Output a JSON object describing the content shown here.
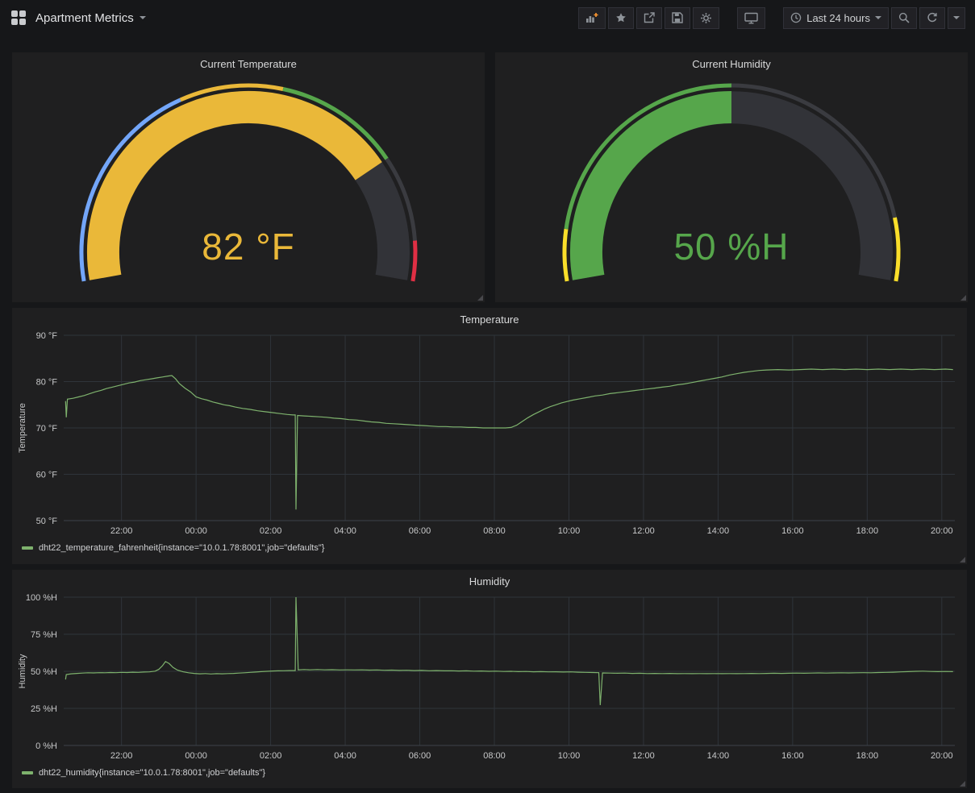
{
  "navbar": {
    "title": "Apartment Metrics",
    "time_range": "Last 24 hours",
    "icons": [
      "grafana-grid",
      "add-panel",
      "star",
      "share",
      "save",
      "settings",
      "cycle-view",
      "clock",
      "zoom-out",
      "refresh",
      "caret-down"
    ]
  },
  "chart_data": [
    {
      "type": "gauge",
      "title": "Current Temperature",
      "value": 82,
      "unit": "°F",
      "display": "82 °F",
      "min": 50,
      "max": 91,
      "fill_fraction": 0.78,
      "fill_color": "#eab839",
      "value_color": "#eab839",
      "ring": [
        {
          "from": 0.0,
          "to": 0.38,
          "color": "#73a6f9"
        },
        {
          "from": 0.38,
          "to": 0.56,
          "color": "#eab839"
        },
        {
          "from": 0.56,
          "to": 0.78,
          "color": "#56a64b"
        },
        {
          "from": 0.78,
          "to": 0.93,
          "color": "#3a3b40"
        },
        {
          "from": 0.93,
          "to": 1.0,
          "color": "#e02f44"
        }
      ]
    },
    {
      "type": "gauge",
      "title": "Current Humidity",
      "value": 50,
      "unit": "%H",
      "display": "50 %H",
      "min": 0,
      "max": 100,
      "fill_fraction": 0.5,
      "fill_color": "#56a64b",
      "value_color": "#56a64b",
      "ring": [
        {
          "from": 0.0,
          "to": 0.09,
          "color": "#fade2a"
        },
        {
          "from": 0.09,
          "to": 0.5,
          "color": "#56a64b"
        },
        {
          "from": 0.5,
          "to": 0.89,
          "color": "#3a3b40"
        },
        {
          "from": 0.89,
          "to": 1.0,
          "color": "#fade2a"
        }
      ]
    },
    {
      "type": "line",
      "title": "Temperature",
      "ylabel": "Temperature",
      "legend": "dht22_temperature_fahrenheit{instance=\"10.0.1.78:8001\",job=\"defaults\"}",
      "color": "#7eb26d",
      "x_unit": "hours since 22:00",
      "x_domain": [
        -1.55,
        22.35
      ],
      "y_domain": [
        50,
        90
      ],
      "x_ticks": [
        0,
        2,
        4,
        6,
        8,
        10,
        12,
        14,
        16,
        18,
        20,
        22
      ],
      "x_tick_labels": [
        "22:00",
        "00:00",
        "02:00",
        "04:00",
        "06:00",
        "08:00",
        "10:00",
        "12:00",
        "14:00",
        "16:00",
        "18:00",
        "20:00"
      ],
      "y_ticks": [
        50,
        60,
        70,
        80,
        90
      ],
      "y_tick_labels": [
        "50 °F",
        "60 °F",
        "70 °F",
        "80 °F",
        "90 °F"
      ],
      "points": [
        [
          -1.5,
          75.8
        ],
        [
          -1.48,
          72.3
        ],
        [
          -1.45,
          76.2
        ],
        [
          -1.3,
          76.4
        ],
        [
          -1.15,
          76.7
        ],
        [
          -1.0,
          77.0
        ],
        [
          -0.85,
          77.4
        ],
        [
          -0.7,
          77.8
        ],
        [
          -0.55,
          78.1
        ],
        [
          -0.4,
          78.5
        ],
        [
          -0.25,
          78.8
        ],
        [
          -0.1,
          79.1
        ],
        [
          0.05,
          79.4
        ],
        [
          0.2,
          79.7
        ],
        [
          0.35,
          79.9
        ],
        [
          0.5,
          80.2
        ],
        [
          0.65,
          80.4
        ],
        [
          0.8,
          80.6
        ],
        [
          0.95,
          80.8
        ],
        [
          1.1,
          81.0
        ],
        [
          1.25,
          81.2
        ],
        [
          1.35,
          81.3
        ],
        [
          1.45,
          80.6
        ],
        [
          1.55,
          79.6
        ],
        [
          1.7,
          78.6
        ],
        [
          1.85,
          77.8
        ],
        [
          2.0,
          76.7
        ],
        [
          2.15,
          76.3
        ],
        [
          2.3,
          76.0
        ],
        [
          2.45,
          75.6
        ],
        [
          2.6,
          75.3
        ],
        [
          2.75,
          75.0
        ],
        [
          2.9,
          74.8
        ],
        [
          3.05,
          74.5
        ],
        [
          3.25,
          74.2
        ],
        [
          3.45,
          74.0
        ],
        [
          3.65,
          73.7
        ],
        [
          3.85,
          73.5
        ],
        [
          4.05,
          73.3
        ],
        [
          4.25,
          73.1
        ],
        [
          4.45,
          72.9
        ],
        [
          4.6,
          72.8
        ],
        [
          4.66,
          72.8
        ],
        [
          4.68,
          52.4
        ],
        [
          4.72,
          72.7
        ],
        [
          4.9,
          72.6
        ],
        [
          5.1,
          72.5
        ],
        [
          5.3,
          72.4
        ],
        [
          5.5,
          72.3
        ],
        [
          5.7,
          72.1
        ],
        [
          5.9,
          72.0
        ],
        [
          6.1,
          71.8
        ],
        [
          6.3,
          71.7
        ],
        [
          6.5,
          71.5
        ],
        [
          6.7,
          71.3
        ],
        [
          6.9,
          71.2
        ],
        [
          7.1,
          71.0
        ],
        [
          7.3,
          70.9
        ],
        [
          7.5,
          70.8
        ],
        [
          7.7,
          70.7
        ],
        [
          7.9,
          70.6
        ],
        [
          8.1,
          70.5
        ],
        [
          8.3,
          70.4
        ],
        [
          8.5,
          70.3
        ],
        [
          8.7,
          70.3
        ],
        [
          8.9,
          70.2
        ],
        [
          9.1,
          70.2
        ],
        [
          9.3,
          70.1
        ],
        [
          9.5,
          70.1
        ],
        [
          9.7,
          70.0
        ],
        [
          9.9,
          70.0
        ],
        [
          10.1,
          70.0
        ],
        [
          10.3,
          70.0
        ],
        [
          10.45,
          70.1
        ],
        [
          10.6,
          70.6
        ],
        [
          10.75,
          71.4
        ],
        [
          10.9,
          72.2
        ],
        [
          11.05,
          72.9
        ],
        [
          11.2,
          73.5
        ],
        [
          11.35,
          74.1
        ],
        [
          11.5,
          74.6
        ],
        [
          11.65,
          75.0
        ],
        [
          11.8,
          75.4
        ],
        [
          11.95,
          75.7
        ],
        [
          12.1,
          76.0
        ],
        [
          12.3,
          76.3
        ],
        [
          12.5,
          76.6
        ],
        [
          12.7,
          76.9
        ],
        [
          12.9,
          77.1
        ],
        [
          13.1,
          77.4
        ],
        [
          13.3,
          77.6
        ],
        [
          13.5,
          77.8
        ],
        [
          13.7,
          78.0
        ],
        [
          13.9,
          78.2
        ],
        [
          14.1,
          78.4
        ],
        [
          14.3,
          78.6
        ],
        [
          14.5,
          78.8
        ],
        [
          14.7,
          79.0
        ],
        [
          14.9,
          79.3
        ],
        [
          15.1,
          79.5
        ],
        [
          15.3,
          79.8
        ],
        [
          15.5,
          80.1
        ],
        [
          15.7,
          80.4
        ],
        [
          15.9,
          80.7
        ],
        [
          16.1,
          81.0
        ],
        [
          16.3,
          81.4
        ],
        [
          16.5,
          81.7
        ],
        [
          16.7,
          82.0
        ],
        [
          16.9,
          82.2
        ],
        [
          17.1,
          82.4
        ],
        [
          17.3,
          82.5
        ],
        [
          17.6,
          82.6
        ],
        [
          17.9,
          82.5
        ],
        [
          18.2,
          82.6
        ],
        [
          18.5,
          82.7
        ],
        [
          18.8,
          82.6
        ],
        [
          19.1,
          82.7
        ],
        [
          19.4,
          82.6
        ],
        [
          19.7,
          82.7
        ],
        [
          20.0,
          82.6
        ],
        [
          20.3,
          82.7
        ],
        [
          20.6,
          82.6
        ],
        [
          20.9,
          82.7
        ],
        [
          21.2,
          82.6
        ],
        [
          21.5,
          82.7
        ],
        [
          21.8,
          82.6
        ],
        [
          22.1,
          82.7
        ],
        [
          22.3,
          82.6
        ]
      ]
    },
    {
      "type": "line",
      "title": "Humidity",
      "ylabel": "Humidity",
      "legend": "dht22_humidity{instance=\"10.0.1.78:8001\",job=\"defaults\"}",
      "color": "#7eb26d",
      "x_unit": "hours since 22:00",
      "x_domain": [
        -1.55,
        22.35
      ],
      "y_domain": [
        0,
        100
      ],
      "x_ticks": [
        0,
        2,
        4,
        6,
        8,
        10,
        12,
        14,
        16,
        18,
        20,
        22
      ],
      "x_tick_labels": [
        "22:00",
        "00:00",
        "02:00",
        "04:00",
        "06:00",
        "08:00",
        "10:00",
        "12:00",
        "14:00",
        "16:00",
        "18:00",
        "20:00"
      ],
      "y_ticks": [
        0,
        25,
        50,
        75,
        100
      ],
      "y_tick_labels": [
        "0 %H",
        "25 %H",
        "50 %H",
        "75 %H",
        "100 %H"
      ],
      "points": [
        [
          -1.5,
          44.5
        ],
        [
          -1.48,
          47.8
        ],
        [
          -1.35,
          48.3
        ],
        [
          -1.2,
          48.6
        ],
        [
          -1.05,
          48.8
        ],
        [
          -0.9,
          49.0
        ],
        [
          -0.75,
          48.9
        ],
        [
          -0.6,
          49.1
        ],
        [
          -0.45,
          49.0
        ],
        [
          -0.3,
          49.2
        ],
        [
          -0.15,
          49.1
        ],
        [
          0.0,
          49.3
        ],
        [
          0.15,
          49.2
        ],
        [
          0.3,
          49.4
        ],
        [
          0.45,
          49.3
        ],
        [
          0.6,
          49.5
        ],
        [
          0.75,
          49.6
        ],
        [
          0.9,
          50.1
        ],
        [
          1.0,
          51.3
        ],
        [
          1.1,
          53.8
        ],
        [
          1.18,
          56.6
        ],
        [
          1.28,
          55.2
        ],
        [
          1.38,
          52.6
        ],
        [
          1.5,
          50.8
        ],
        [
          1.65,
          49.7
        ],
        [
          1.8,
          49.0
        ],
        [
          1.95,
          48.6
        ],
        [
          2.1,
          48.3
        ],
        [
          2.25,
          48.5
        ],
        [
          2.4,
          48.2
        ],
        [
          2.55,
          48.4
        ],
        [
          2.7,
          48.3
        ],
        [
          2.85,
          48.5
        ],
        [
          3.0,
          48.6
        ],
        [
          3.15,
          48.8
        ],
        [
          3.3,
          49.0
        ],
        [
          3.45,
          49.3
        ],
        [
          3.6,
          49.5
        ],
        [
          3.75,
          49.8
        ],
        [
          3.9,
          50.0
        ],
        [
          4.05,
          50.2
        ],
        [
          4.2,
          50.3
        ],
        [
          4.35,
          50.4
        ],
        [
          4.5,
          50.5
        ],
        [
          4.66,
          50.5
        ],
        [
          4.68,
          100.0
        ],
        [
          4.74,
          51.0
        ],
        [
          4.9,
          51.2
        ],
        [
          5.05,
          51.0
        ],
        [
          5.25,
          51.2
        ],
        [
          5.45,
          51.0
        ],
        [
          5.65,
          51.1
        ],
        [
          5.85,
          50.9
        ],
        [
          6.05,
          51.0
        ],
        [
          6.25,
          50.9
        ],
        [
          6.45,
          51.0
        ],
        [
          6.65,
          50.8
        ],
        [
          6.85,
          50.9
        ],
        [
          7.05,
          50.7
        ],
        [
          7.25,
          50.8
        ],
        [
          7.45,
          50.6
        ],
        [
          7.65,
          50.7
        ],
        [
          7.85,
          50.5
        ],
        [
          8.05,
          50.6
        ],
        [
          8.25,
          50.4
        ],
        [
          8.45,
          50.5
        ],
        [
          8.65,
          50.3
        ],
        [
          8.85,
          50.4
        ],
        [
          9.05,
          50.2
        ],
        [
          9.25,
          50.3
        ],
        [
          9.45,
          50.1
        ],
        [
          9.65,
          50.2
        ],
        [
          9.85,
          50.0
        ],
        [
          10.05,
          50.1
        ],
        [
          10.25,
          49.9
        ],
        [
          10.45,
          50.0
        ],
        [
          10.65,
          49.8
        ],
        [
          10.85,
          49.9
        ],
        [
          11.05,
          49.7
        ],
        [
          11.25,
          49.8
        ],
        [
          11.45,
          49.6
        ],
        [
          11.65,
          49.7
        ],
        [
          11.85,
          49.5
        ],
        [
          12.05,
          49.6
        ],
        [
          12.25,
          49.4
        ],
        [
          12.45,
          49.3
        ],
        [
          12.65,
          49.2
        ],
        [
          12.8,
          49.1
        ],
        [
          12.84,
          27.2
        ],
        [
          12.9,
          48.9
        ],
        [
          13.1,
          48.8
        ],
        [
          13.3,
          48.7
        ],
        [
          13.5,
          48.8
        ],
        [
          13.7,
          48.6
        ],
        [
          13.9,
          48.7
        ],
        [
          14.1,
          48.5
        ],
        [
          14.3,
          48.6
        ],
        [
          14.5,
          48.5
        ],
        [
          14.7,
          48.6
        ],
        [
          14.9,
          48.4
        ],
        [
          15.1,
          48.5
        ],
        [
          15.3,
          48.4
        ],
        [
          15.5,
          48.5
        ],
        [
          15.7,
          48.4
        ],
        [
          15.9,
          48.5
        ],
        [
          16.1,
          48.4
        ],
        [
          16.3,
          48.5
        ],
        [
          16.5,
          48.4
        ],
        [
          16.7,
          48.5
        ],
        [
          16.9,
          48.6
        ],
        [
          17.1,
          48.5
        ],
        [
          17.3,
          48.6
        ],
        [
          17.5,
          48.7
        ],
        [
          17.7,
          48.6
        ],
        [
          17.9,
          48.7
        ],
        [
          18.1,
          48.8
        ],
        [
          18.3,
          48.7
        ],
        [
          18.5,
          48.8
        ],
        [
          18.7,
          48.9
        ],
        [
          18.9,
          48.8
        ],
        [
          19.1,
          48.9
        ],
        [
          19.3,
          49.0
        ],
        [
          19.5,
          48.9
        ],
        [
          19.7,
          49.0
        ],
        [
          19.9,
          49.1
        ],
        [
          20.1,
          49.0
        ],
        [
          20.3,
          49.2
        ],
        [
          20.5,
          49.3
        ],
        [
          20.7,
          49.4
        ],
        [
          20.9,
          49.6
        ],
        [
          21.1,
          49.8
        ],
        [
          21.3,
          50.0
        ],
        [
          21.5,
          50.1
        ],
        [
          21.7,
          49.9
        ],
        [
          21.9,
          49.8
        ],
        [
          22.1,
          49.9
        ],
        [
          22.3,
          49.8
        ]
      ]
    }
  ]
}
